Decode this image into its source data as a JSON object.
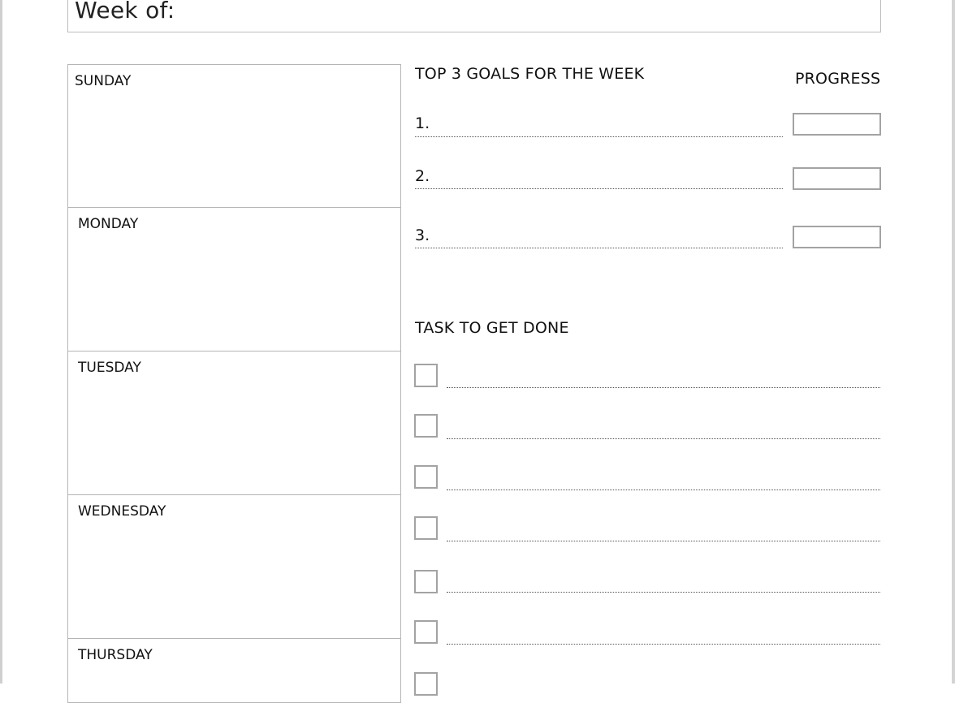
{
  "header": {
    "week_of_label": "Week of:"
  },
  "days": [
    {
      "label": "SUNDAY"
    },
    {
      "label": "MONDAY"
    },
    {
      "label": "TUESDAY"
    },
    {
      "label": "WEDNESDAY"
    },
    {
      "label": "THURSDAY"
    }
  ],
  "goals": {
    "title": "TOP 3 GOALS FOR THE WEEK",
    "progress_label": "PROGRESS",
    "items": [
      {
        "number": "1.",
        "text": "",
        "progress": ""
      },
      {
        "number": "2.",
        "text": "",
        "progress": ""
      },
      {
        "number": "3.",
        "text": "",
        "progress": ""
      }
    ]
  },
  "tasks": {
    "title": "TASK TO GET DONE",
    "items": [
      {
        "checked": false,
        "text": ""
      },
      {
        "checked": false,
        "text": ""
      },
      {
        "checked": false,
        "text": ""
      },
      {
        "checked": false,
        "text": ""
      },
      {
        "checked": false,
        "text": ""
      },
      {
        "checked": false,
        "text": ""
      },
      {
        "checked": false,
        "text": ""
      }
    ]
  }
}
